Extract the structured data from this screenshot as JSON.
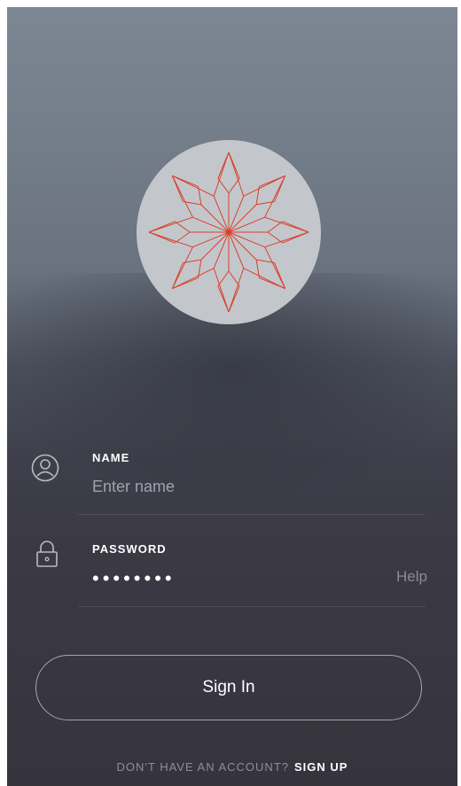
{
  "logo": {
    "icon": "star-mandala-icon",
    "circle_color": "#c3c7cb",
    "line_color": "#d8402a"
  },
  "name_field": {
    "icon": "user-circle-icon",
    "label": "NAME",
    "placeholder": "Enter name"
  },
  "password_field": {
    "icon": "lock-icon",
    "label": "PASSWORD",
    "value": "••••••••",
    "help_label": "Help"
  },
  "sign_in": {
    "label": "Sign In"
  },
  "footer": {
    "prompt": "DON'T HAVE AN ACCOUNT?",
    "signup_label": "SIGN UP"
  }
}
